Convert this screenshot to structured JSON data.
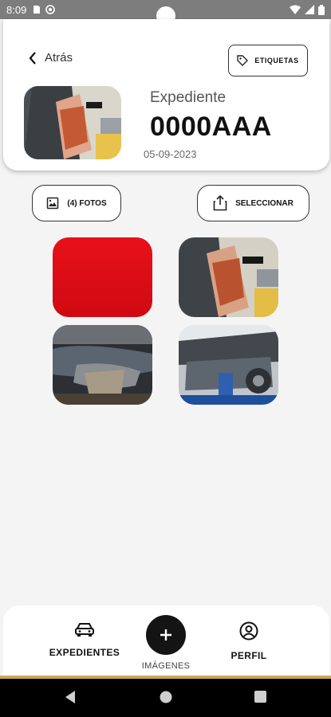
{
  "status_bar": {
    "time": "8:09"
  },
  "header": {
    "back_label": "Atrás",
    "tags_label": "ETIQUETAS",
    "expediente_label": "Expediente",
    "expediente_code": "0000AAA",
    "date": "05-09-2023"
  },
  "actions": {
    "photos_label": "(4) FOTOS",
    "select_label": "SELECCIONAR"
  },
  "photos": [
    {
      "name": "red-car-photo"
    },
    {
      "name": "door-interior-photo"
    },
    {
      "name": "front-damage-photo"
    },
    {
      "name": "engine-bay-photo"
    }
  ],
  "bottom_nav": {
    "expedientes_label": "EXPEDIENTES",
    "images_label": "IMÁGENES",
    "profile_label": "PERFIL"
  },
  "colors": {
    "accent_gold": "#c9a94a",
    "fab": "#141414",
    "red_photo": "#e8101a"
  }
}
